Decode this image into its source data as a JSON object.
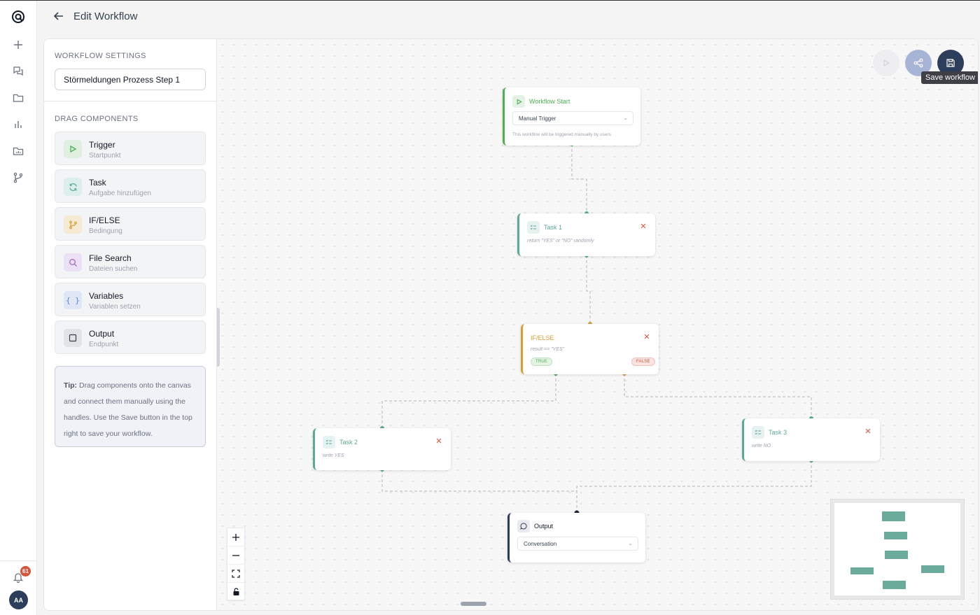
{
  "header": {
    "title": "Edit Workflow"
  },
  "rail": {
    "notification_count": "61",
    "avatar_initials": "AA"
  },
  "settings": {
    "section_title": "WORKFLOW SETTINGS",
    "workflow_name": "Störmeldungen Prozess Step 1",
    "components_title": "DRAG COMPONENTS",
    "components": [
      {
        "title": "Trigger",
        "subtitle": "Startpunkt",
        "icon": "play-icon",
        "color": "#4caf50"
      },
      {
        "title": "Task",
        "subtitle": "Aufgabe hinzufügen",
        "icon": "refresh-icon",
        "color": "#5aa897"
      },
      {
        "title": "IF/ELSE",
        "subtitle": "Bedingung",
        "icon": "branch-icon",
        "color": "#d4a037"
      },
      {
        "title": "File Search",
        "subtitle": "Dateien suchen",
        "icon": "search-icon",
        "color": "#9b6fc2"
      },
      {
        "title": "Variables",
        "subtitle": "Variablen setzen",
        "icon": "braces-icon",
        "color": "#5b86d6"
      },
      {
        "title": "Output",
        "subtitle": "Endpunkt",
        "icon": "square-icon",
        "color": "#374151"
      }
    ],
    "tip_label": "Tip:",
    "tip_text": " Drag components onto the canvas and connect them manually using the handles. Use the Save button in the top right to save your workflow."
  },
  "toolbar": {
    "save_tooltip": "Save workflow"
  },
  "nodes": {
    "start": {
      "title": "Workflow Start",
      "select": "Manual Trigger",
      "desc": "This workflow will be triggered manually by users"
    },
    "task1": {
      "title": "Task 1",
      "desc": "return \"YES\" or \"NO\" randomly"
    },
    "ifelse": {
      "title": "IF/ELSE",
      "desc": "result == \"YES\"",
      "true_label": "TRUE",
      "false_label": "FALSE"
    },
    "task2": {
      "title": "Task 2",
      "desc": "write YES"
    },
    "task3": {
      "title": "Task 3",
      "desc": "write NO"
    },
    "output": {
      "title": "Output",
      "select": "Conversation"
    }
  },
  "colors": {
    "trigger": "#4caf50",
    "task": "#5aa897",
    "ifelse": "#d4a037",
    "output": "#2d3e5c",
    "delete": "#d4553b",
    "primary": "#2d3e5c"
  }
}
